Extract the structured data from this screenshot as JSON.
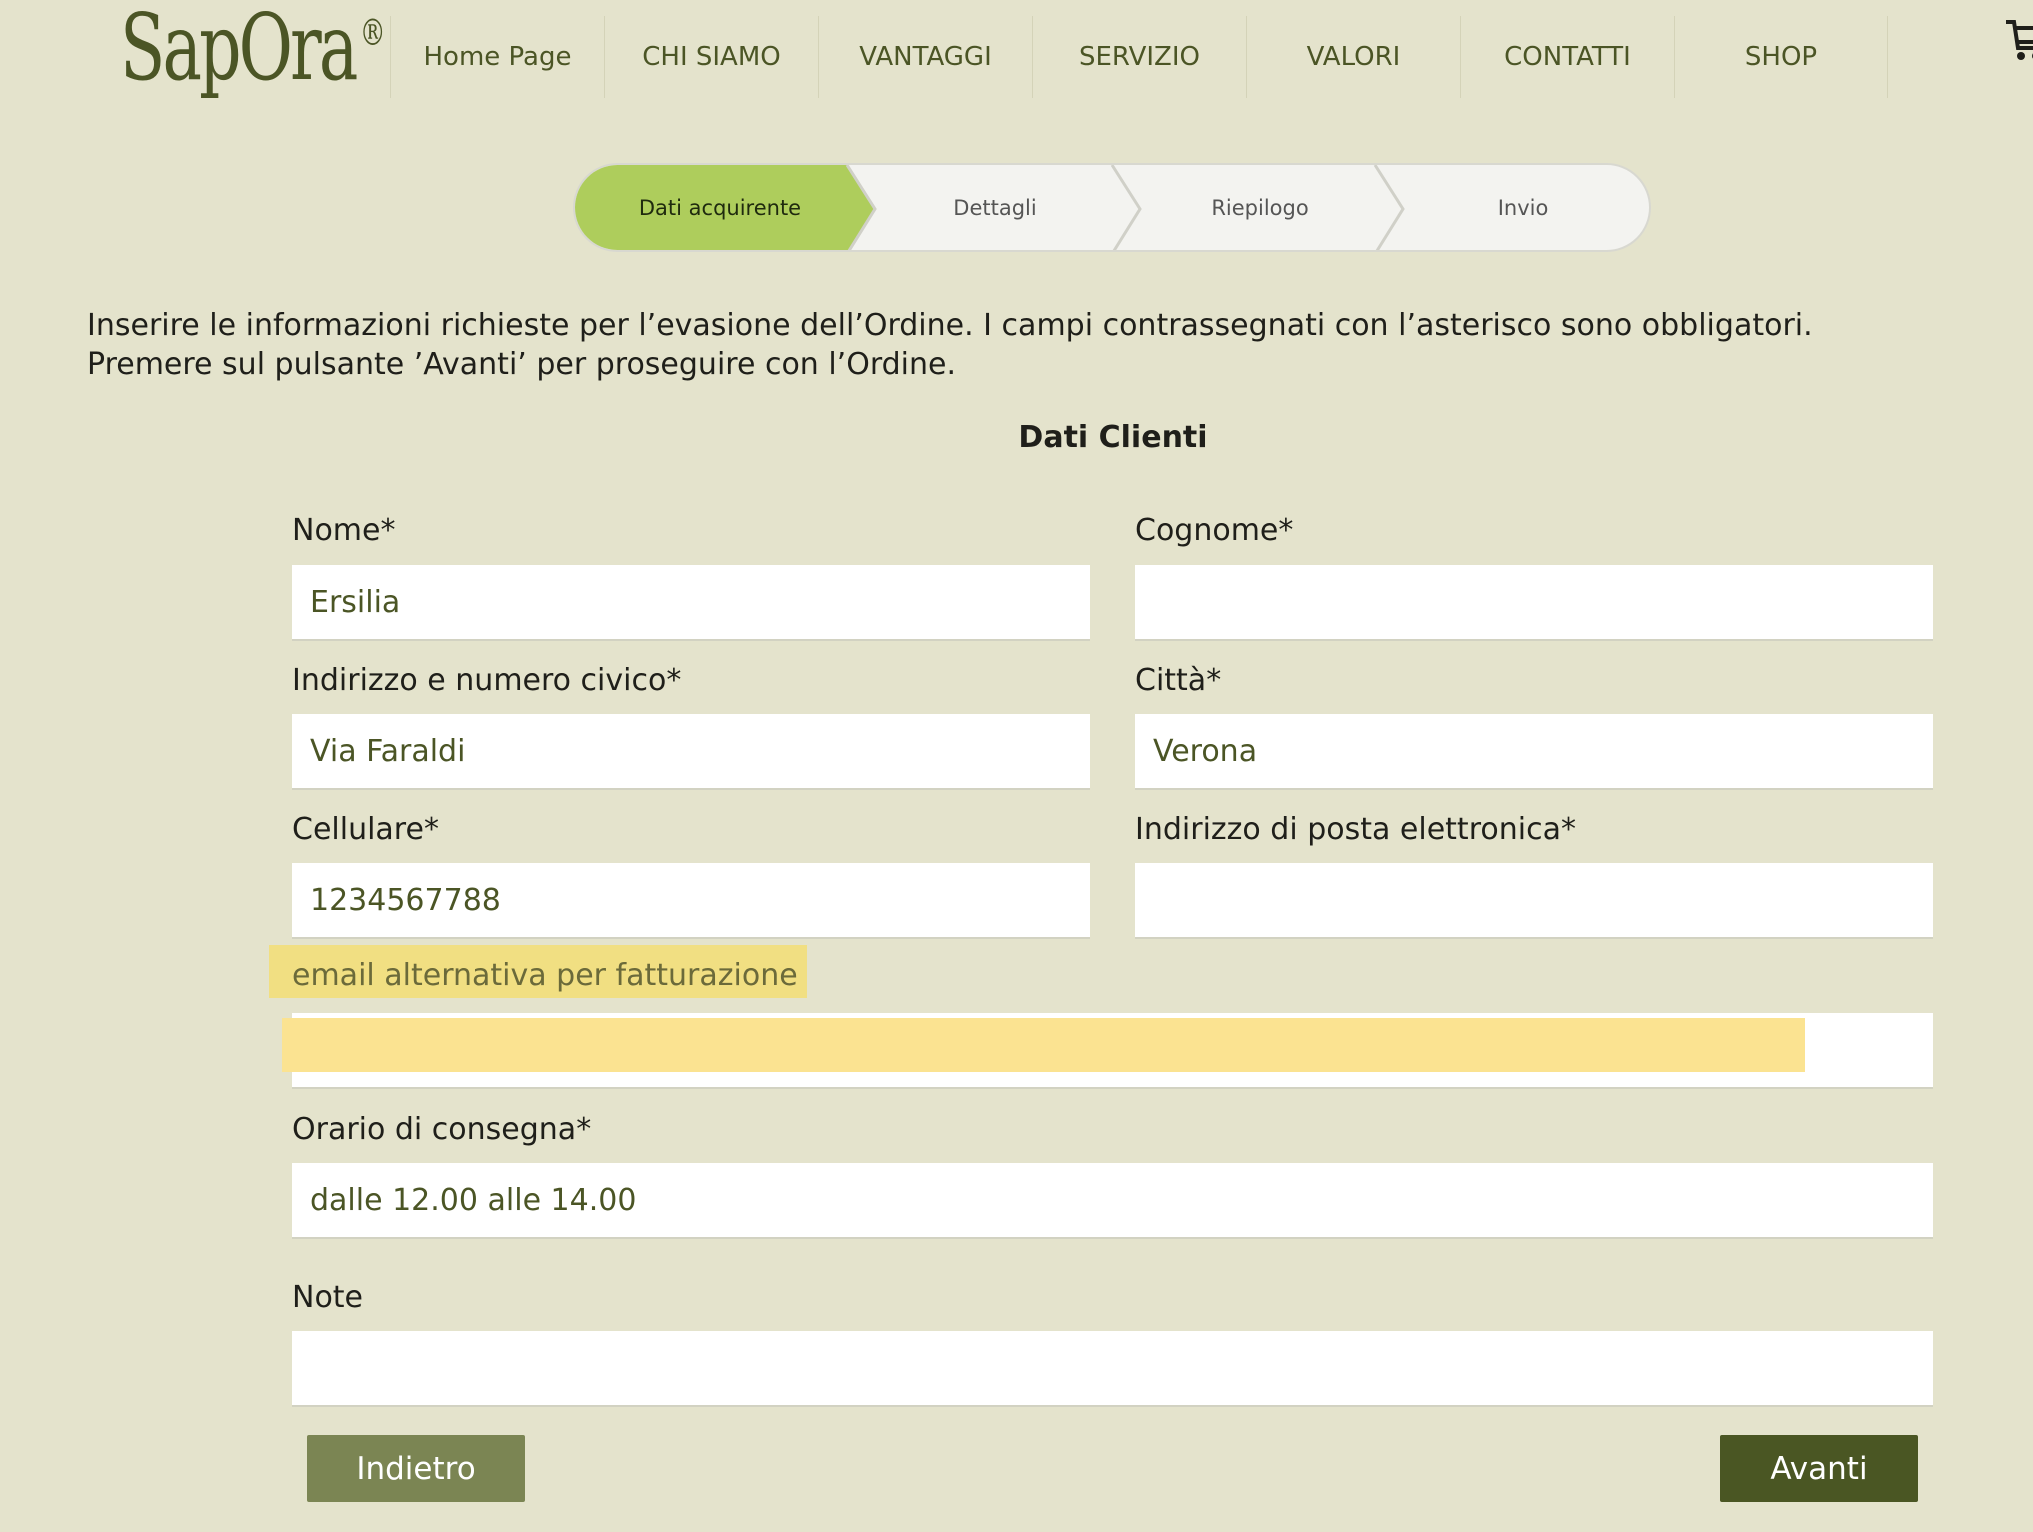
{
  "header": {
    "logo_text": "SapOra",
    "logo_mark": "®",
    "nav": [
      "Home Page",
      "CHI SIAMO",
      "VANTAGGI",
      "SERVIZIO",
      "VALORI",
      "CONTATTI",
      "SHOP"
    ],
    "cart_icon": "cart-icon"
  },
  "stepper": {
    "steps": [
      "Dati acquirente",
      "Dettagli",
      "Riepilogo",
      "Invio"
    ],
    "active_color": "#aecd5c"
  },
  "intro": {
    "line1": "Inserire le informazioni richieste per l’evasione dell’Ordine. I campi contrassegnati con l’asterisco sono obbligatori.",
    "line2": "Premere sul pulsante ’Avanti’ per proseguire con l’Ordine."
  },
  "form": {
    "title": "Dati Clienti",
    "nome": {
      "label": "Nome*",
      "value": "Ersilia"
    },
    "cognome": {
      "label": "Cognome*",
      "value": ""
    },
    "indirizzo": {
      "label": "Indirizzo e numero civico*",
      "value": "Via Faraldi"
    },
    "citta": {
      "label": "Città*",
      "value": "Verona"
    },
    "cellulare": {
      "label": "Cellulare*",
      "value": "1234567788"
    },
    "email": {
      "label": "Indirizzo di posta elettronica*",
      "value": ""
    },
    "email_alt": {
      "label": "email alternativa per fatturazione",
      "value": ""
    },
    "orario": {
      "label": "Orario di consegna*",
      "value": "dalle 12.00 alle 14.00"
    },
    "note": {
      "label": "Note",
      "value": ""
    }
  },
  "buttons": {
    "back": "Indietro",
    "next": "Avanti"
  },
  "colors": {
    "background": "#e4e3cc",
    "brand": "#4b5525",
    "highlight": "#fbe391"
  }
}
